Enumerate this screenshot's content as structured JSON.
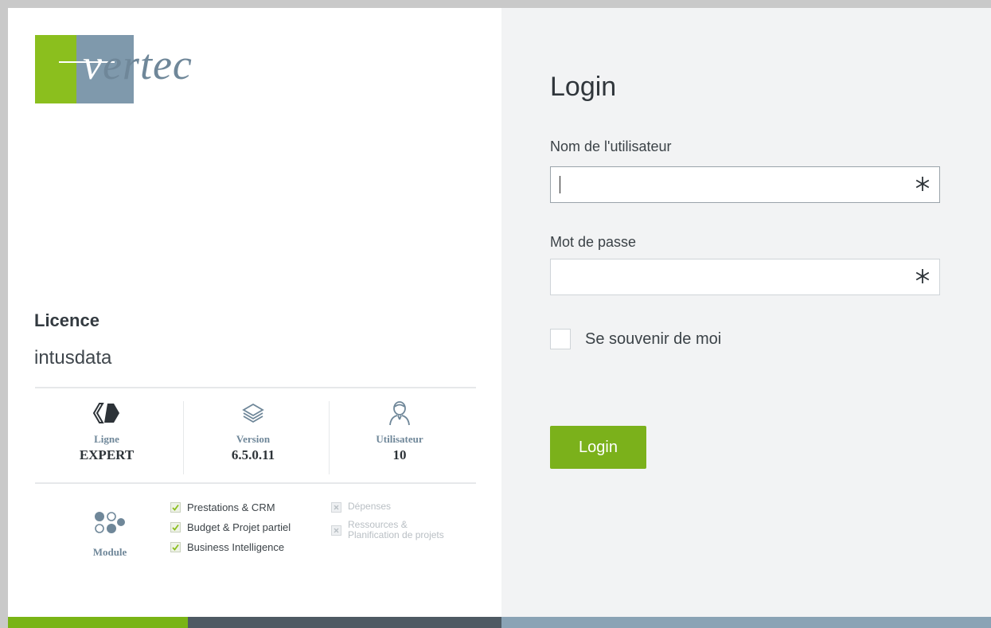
{
  "logo": {
    "text": "vertec",
    "colors": {
      "green": "#8bbf1e",
      "blue": "#7f99ac"
    }
  },
  "licence": {
    "label": "Licence",
    "value": "intusdata"
  },
  "stats": [
    {
      "icon": "product-line-icon",
      "label": "Ligne",
      "value": "EXPERT"
    },
    {
      "icon": "layers-icon",
      "label": "Version",
      "value": "6.5.0.11"
    },
    {
      "icon": "user-icon",
      "label": "Utilisateur",
      "value": "10"
    }
  ],
  "modules": {
    "label": "Module",
    "enabled": [
      "Prestations & CRM",
      "Budget & Projet partiel",
      "Business Intelligence"
    ],
    "disabled": [
      "Dépenses",
      "Ressources &\nPlanification de projets"
    ]
  },
  "login": {
    "title": "Login",
    "username_label": "Nom de l'utilisateur",
    "username_value": "",
    "password_label": "Mot de passe",
    "password_value": "",
    "remember_label": "Se souvenir de moi",
    "button_label": "Login"
  },
  "colors": {
    "accent": "#7bb11b",
    "text_blue": "#6f8799",
    "right_panel": "#f2f3f4"
  }
}
